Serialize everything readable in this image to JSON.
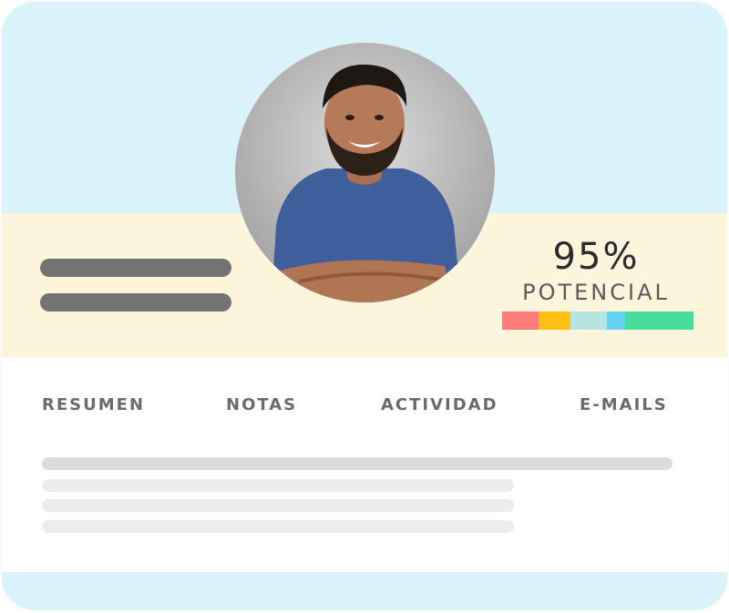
{
  "profile": {
    "potential_value": "95%",
    "potential_label": "POTENCIAL"
  },
  "tabs": [
    {
      "label": "RESUMEN"
    },
    {
      "label": "NOTAS"
    },
    {
      "label": "ACTIVIDAD"
    },
    {
      "label": "E-MAILS"
    }
  ],
  "colors": {
    "top_band": "#daf3fb",
    "middle_band": "#fdf4dc",
    "bottom_band": "#daf3fb",
    "strip": [
      "#ff7c7b",
      "#fec012",
      "#b7e3e1",
      "#66d2f3",
      "#47dc9c"
    ]
  }
}
